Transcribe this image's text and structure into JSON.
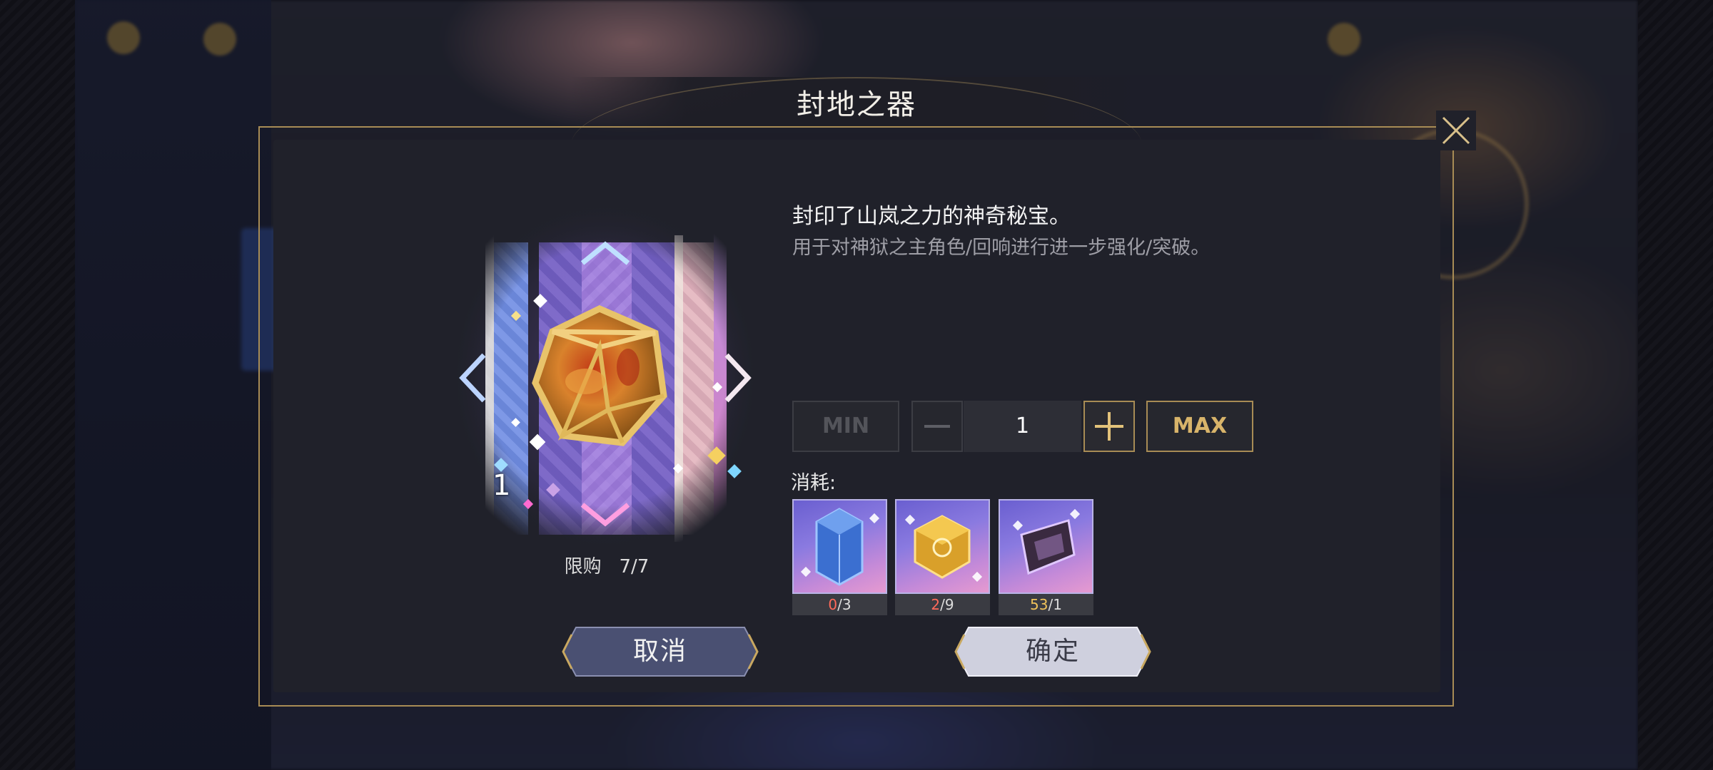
{
  "dialog": {
    "title": "封地之器"
  },
  "item": {
    "name_line": "封印了山岚之力的神奇秘宝。",
    "description": "用于对神狱之主角色/回响进行进一步强化/突破。",
    "count": "1",
    "purchase_limit_label": "限购",
    "purchase_limit_value": "7/7"
  },
  "quantity": {
    "min_label": "MIN",
    "max_label": "MAX",
    "value": "1"
  },
  "cost": {
    "label": "消耗:",
    "items": [
      {
        "icon": "blue-crystal-icon",
        "have": "0",
        "need": "3",
        "have_color": "#ff6a5a"
      },
      {
        "icon": "gold-cube-icon",
        "have": "2",
        "need": "9",
        "have_color": "#ff6a5a"
      },
      {
        "icon": "dark-shard-icon",
        "have": "53",
        "need": "1",
        "have_color": "#f0c35a"
      }
    ]
  },
  "buttons": {
    "cancel": "取消",
    "confirm": "确定"
  },
  "colors": {
    "gold_accent": "#a88c55",
    "panel_bg": "#20212a"
  }
}
